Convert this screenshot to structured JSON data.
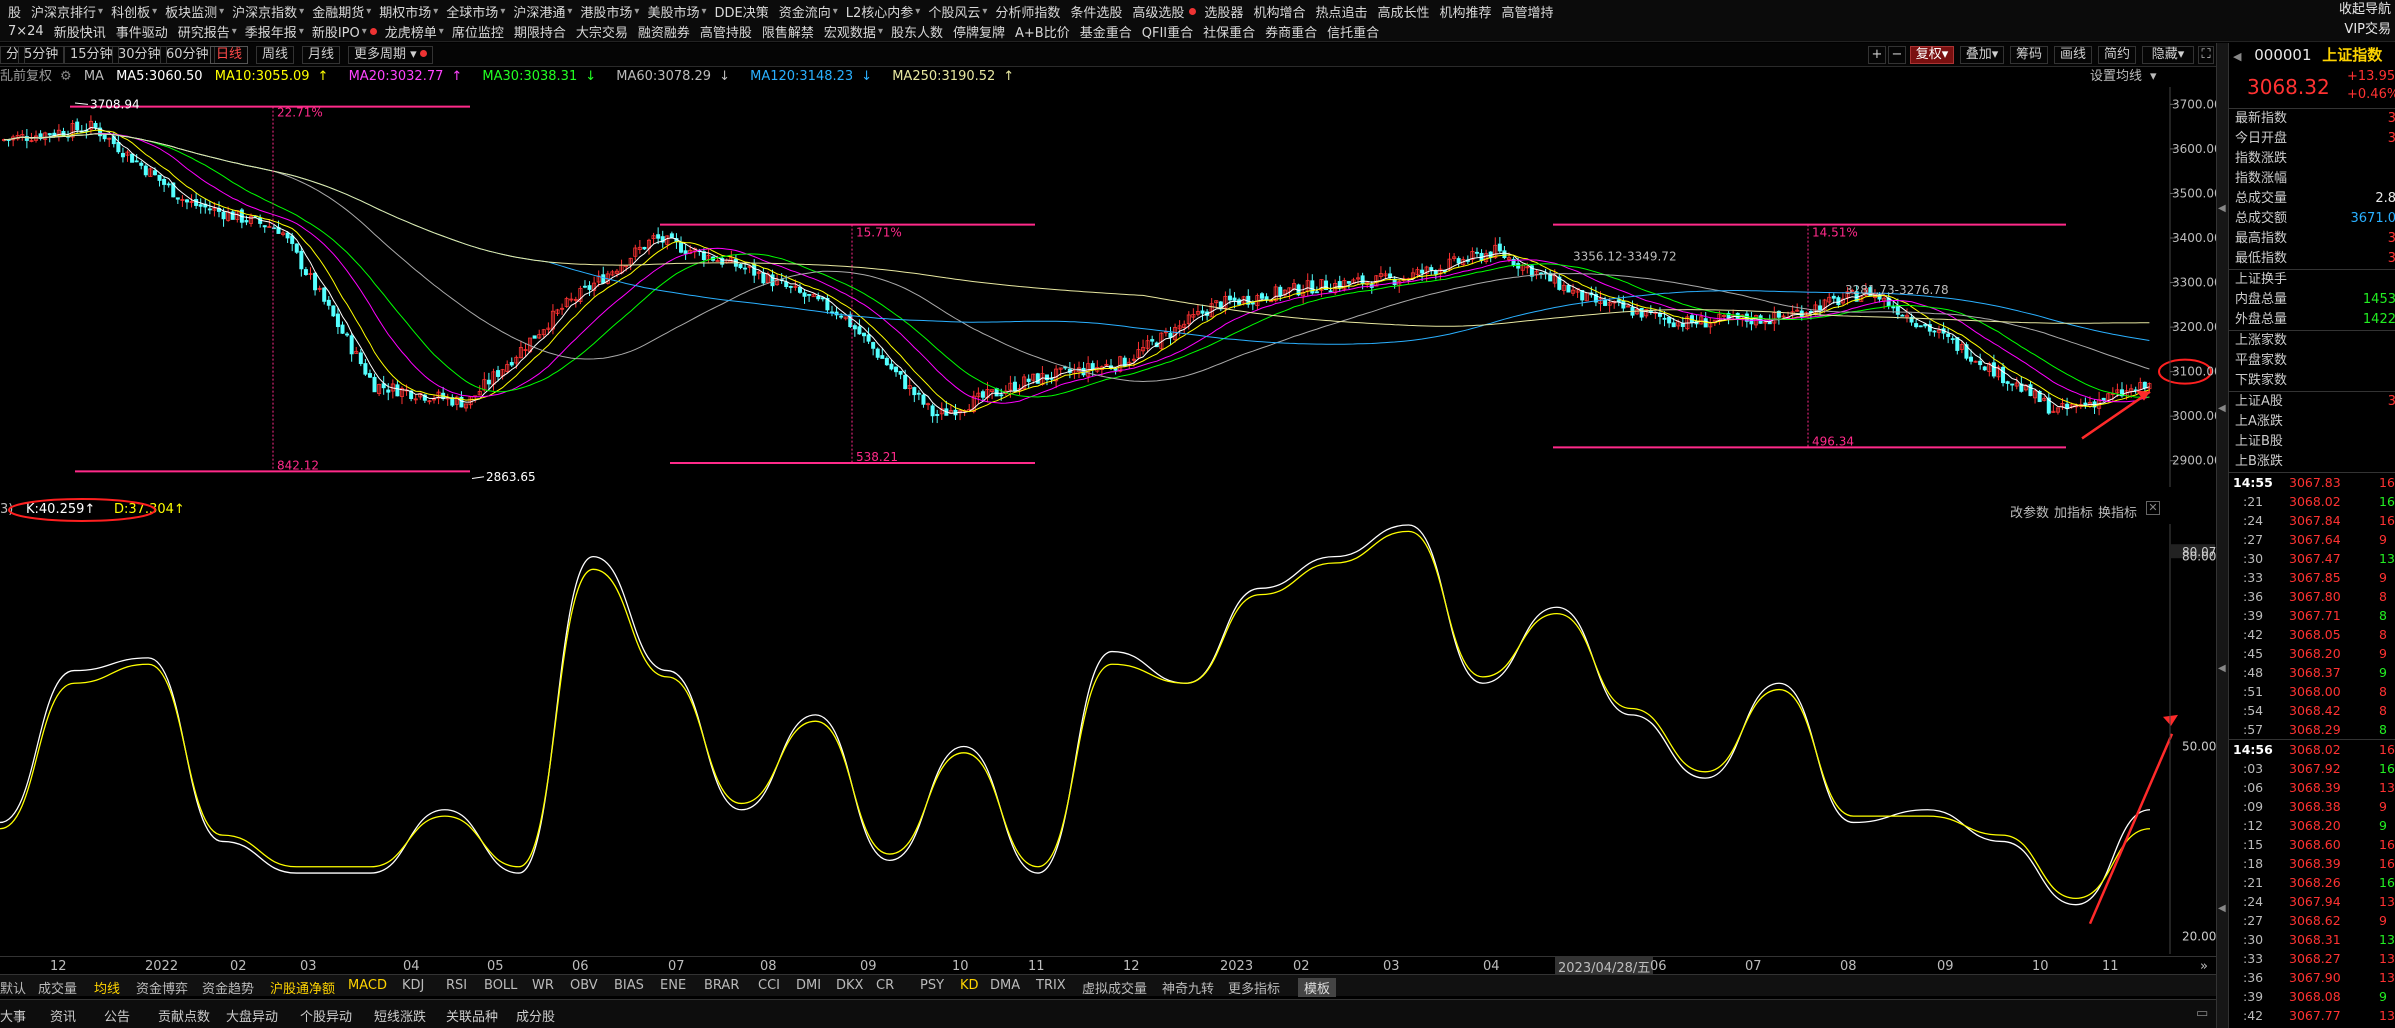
{
  "menu": {
    "row1": [
      "股",
      "沪深京排行",
      "科创板",
      "板块监测",
      "沪深京指数",
      "金融期货",
      "期权市场",
      "全球市场",
      "沪深港通",
      "港股市场",
      "美股市场",
      "DDE决策",
      "资金流向",
      "L2核心内参",
      "个股风云",
      "分析师指数",
      "条件选股",
      "高级选股",
      "选股器",
      "机构增合",
      "热点追击",
      "高成长性",
      "机构推荐",
      "高管增持"
    ],
    "row2": [
      "7×24",
      "新股快讯",
      "事件驱动",
      "研究报告",
      "季报年报",
      "新股IPO",
      "龙虎榜单",
      "席位监控",
      "期限持合",
      "大宗交易",
      "融资融券",
      "高管持股",
      "限售解禁",
      "宏观数据",
      "股东人数",
      "停牌复牌",
      "A+B比价",
      "基金重合",
      "QFII重合",
      "社保重合",
      "券商重合",
      "信托重合"
    ],
    "vip": [
      "收起导航",
      "VIP交易"
    ]
  },
  "periods": [
    "分",
    "5分钟",
    "15分钟",
    "30分钟",
    "60分钟",
    "日线",
    "周线",
    "月线",
    "更多周期"
  ],
  "active_period": "日线",
  "toolbar": {
    "plus": "+",
    "minus": "−",
    "fuquan": "复权",
    "diejia": "叠加",
    "chouma": "筹码",
    "huaxian": "画线",
    "jianyue": "简约",
    "yincang": "隐藏"
  },
  "ma": {
    "prefix": "乱前复权",
    "ma_label": "MA",
    "ma5": "MA5:3060.50",
    "ma10": "MA10:3055.09",
    "ma20": "MA20:3032.77",
    "ma30": "MA30:3038.31",
    "ma60": "MA60:3078.29",
    "ma120": "MA120:3148.23",
    "ma250": "MA250:3190.52",
    "setting": "设置均线"
  },
  "annotations": {
    "high": "3708.94",
    "low": "2863.65",
    "pct1": "22.71%",
    "pct2": "15.71%",
    "pct3": "14.51%",
    "pts1": "842.12",
    "pts2": "538.21",
    "pts3": "496.34",
    "range1": "3356.12-3349.72",
    "range2": "3281.73-3276.78"
  },
  "y_ticks": [
    "3700.00",
    "3600.00",
    "3500.00",
    "3400.00",
    "3300.00",
    "3200.00",
    "3100.00",
    "3000.00",
    "2900.00"
  ],
  "kd": {
    "k": "K:40.259",
    "d": "D:37.304",
    "prefix": "3)",
    "change_param": "改参数",
    "add_ind": "加指标",
    "swap_ind": "换指标",
    "ticks": [
      "80.07",
      "80.00",
      "50.00",
      "20.00"
    ]
  },
  "x_labels": [
    "12",
    "2022",
    "02",
    "03",
    "04",
    "05",
    "06",
    "07",
    "08",
    "09",
    "10",
    "11",
    "12",
    "2023",
    "02",
    "03",
    "04",
    "2023/04/28/五",
    "06",
    "07",
    "08",
    "09",
    "10",
    "11"
  ],
  "indicators": [
    "默认",
    "成交量",
    "均线",
    "资金博弈",
    "资金趋势",
    "沪股通净额",
    "MACD",
    "KDJ",
    "RSI",
    "BOLL",
    "WR",
    "OBV",
    "BIAS",
    "ENE",
    "BRAR",
    "CCI",
    "DMI",
    "DKX",
    "CR",
    "PSY",
    "KD",
    "DMA",
    "TRIX",
    "虚拟成交量",
    "神奇九转",
    "更多指标",
    "模板"
  ],
  "bottom_tabs": [
    "大事",
    "资讯",
    "公告",
    "贡献点数",
    "大盘异动",
    "个股异动",
    "短线涨跌",
    "关联品种",
    "成分股"
  ],
  "side": {
    "code": "000001",
    "name": "上证指数",
    "price": "3068.32",
    "chg": "+13.95",
    "pct": "+0.46%",
    "quotes": [
      [
        "最新指数",
        "3"
      ],
      [
        "今日开盘",
        "3"
      ],
      [
        "指数涨跌",
        ""
      ],
      [
        "指数涨幅",
        ""
      ],
      [
        "总成交量",
        "2.8"
      ],
      [
        "总成交额",
        "3671.0"
      ],
      [
        "最高指数",
        "3"
      ],
      [
        "最低指数",
        "3"
      ]
    ],
    "quotes2": [
      [
        "上证换手",
        ""
      ],
      [
        "内盘总量",
        "1453"
      ],
      [
        "外盘总量",
        "1422"
      ]
    ],
    "quotes3": [
      [
        "上涨家数",
        ""
      ],
      [
        "平盘家数",
        ""
      ],
      [
        "下跌家数",
        ""
      ]
    ],
    "quotes4": [
      [
        "上证A股",
        "3"
      ],
      [
        "上A涨跌",
        ""
      ],
      [
        "上证B股",
        ""
      ],
      [
        "上B涨跌",
        ""
      ]
    ],
    "ticks1_time": "14:55",
    "ticks1": [
      [
        "14:55",
        "3067.83",
        "16"
      ],
      [
        ":21",
        "3068.02",
        "16"
      ],
      [
        ":24",
        "3067.84",
        "16"
      ],
      [
        ":27",
        "3067.64",
        "9"
      ],
      [
        ":30",
        "3067.47",
        "13"
      ],
      [
        ":33",
        "3067.85",
        "9"
      ],
      [
        ":36",
        "3067.80",
        "8"
      ],
      [
        ":39",
        "3067.71",
        "8"
      ],
      [
        ":42",
        "3068.05",
        "8"
      ],
      [
        ":45",
        "3068.20",
        "9"
      ],
      [
        ":48",
        "3068.37",
        "9"
      ],
      [
        ":51",
        "3068.00",
        "8"
      ],
      [
        ":54",
        "3068.42",
        "8"
      ],
      [
        ":57",
        "3068.29",
        "8"
      ]
    ],
    "ticks2": [
      [
        "14:56",
        "3068.02",
        "16"
      ],
      [
        ":03",
        "3067.92",
        "16"
      ],
      [
        ":06",
        "3068.39",
        "13"
      ],
      [
        ":09",
        "3068.38",
        "9"
      ],
      [
        ":12",
        "3068.20",
        "9"
      ],
      [
        ":15",
        "3068.60",
        "16"
      ],
      [
        ":18",
        "3068.39",
        "16"
      ],
      [
        ":21",
        "3068.26",
        "16"
      ],
      [
        ":24",
        "3067.94",
        "13"
      ],
      [
        ":27",
        "3068.62",
        "9"
      ],
      [
        ":30",
        "3068.31",
        "13"
      ],
      [
        ":33",
        "3068.27",
        "13"
      ],
      [
        ":36",
        "3067.90",
        "13"
      ],
      [
        ":39",
        "3068.08",
        "9"
      ],
      [
        ":42",
        "3067.77",
        "13"
      ]
    ]
  },
  "colors": {
    "up": "#ff3232",
    "down": "#54ffff",
    "ma5": "#ffffff",
    "ma10": "#ffff00",
    "ma20": "#ff00ff",
    "ma30": "#00ff00",
    "ma60": "#aaaaaa",
    "ma120": "#2ab0ff",
    "ma250": "#e8e8a0",
    "annot": "#ff2a8a",
    "k": "#ffffff",
    "d": "#ffff00"
  },
  "chart_data": [
    {
      "type": "candlestick",
      "title": "上证指数 日线",
      "ylim": [
        2863.65,
        3708.94
      ],
      "y_ticks": [
        2900,
        3000,
        3100,
        3200,
        3300,
        3400,
        3500,
        3600,
        3700
      ],
      "close_path_x": [
        "2021-12",
        "2022-01",
        "2022-02",
        "2022-03",
        "2022-04",
        "2022-05",
        "2022-06",
        "2022-07",
        "2022-08",
        "2022-09",
        "2022-10",
        "2022-11",
        "2022-12",
        "2023-01",
        "2023-02",
        "2023-03",
        "2023-04",
        "2023-05",
        "2023-06",
        "2023-07",
        "2023-08",
        "2023-09",
        "2023-10",
        "2023-11"
      ],
      "close_path_y": [
        3620,
        3650,
        3480,
        3420,
        3070,
        3030,
        3240,
        3400,
        3330,
        3230,
        3000,
        3080,
        3120,
        3250,
        3290,
        3310,
        3370,
        3260,
        3210,
        3220,
        3280,
        3150,
        3010,
        3068
      ],
      "ma_values": {
        "MA5": 3060.5,
        "MA10": 3055.09,
        "MA20": 3032.77,
        "MA30": 3038.31,
        "MA60": 3078.29,
        "MA120": 3148.23,
        "MA250": 3190.52
      }
    },
    {
      "type": "line",
      "title": "KD",
      "ylim": [
        20,
        80
      ],
      "series": [
        {
          "name": "K",
          "values": [
            38,
            62,
            64,
            35,
            30,
            30,
            40,
            30,
            80,
            62,
            40,
            55,
            32,
            50,
            30,
            65,
            60,
            75,
            80,
            85,
            60,
            72,
            55,
            45,
            60,
            38,
            40,
            35,
            25,
            40
          ]
        },
        {
          "name": "D",
          "values": [
            37,
            60,
            63,
            36,
            31,
            31,
            39,
            31,
            78,
            61,
            41,
            54,
            33,
            49,
            31,
            63,
            60,
            74,
            79,
            84,
            61,
            71,
            56,
            46,
            59,
            39,
            39,
            36,
            26,
            37
          ]
        }
      ]
    }
  ]
}
